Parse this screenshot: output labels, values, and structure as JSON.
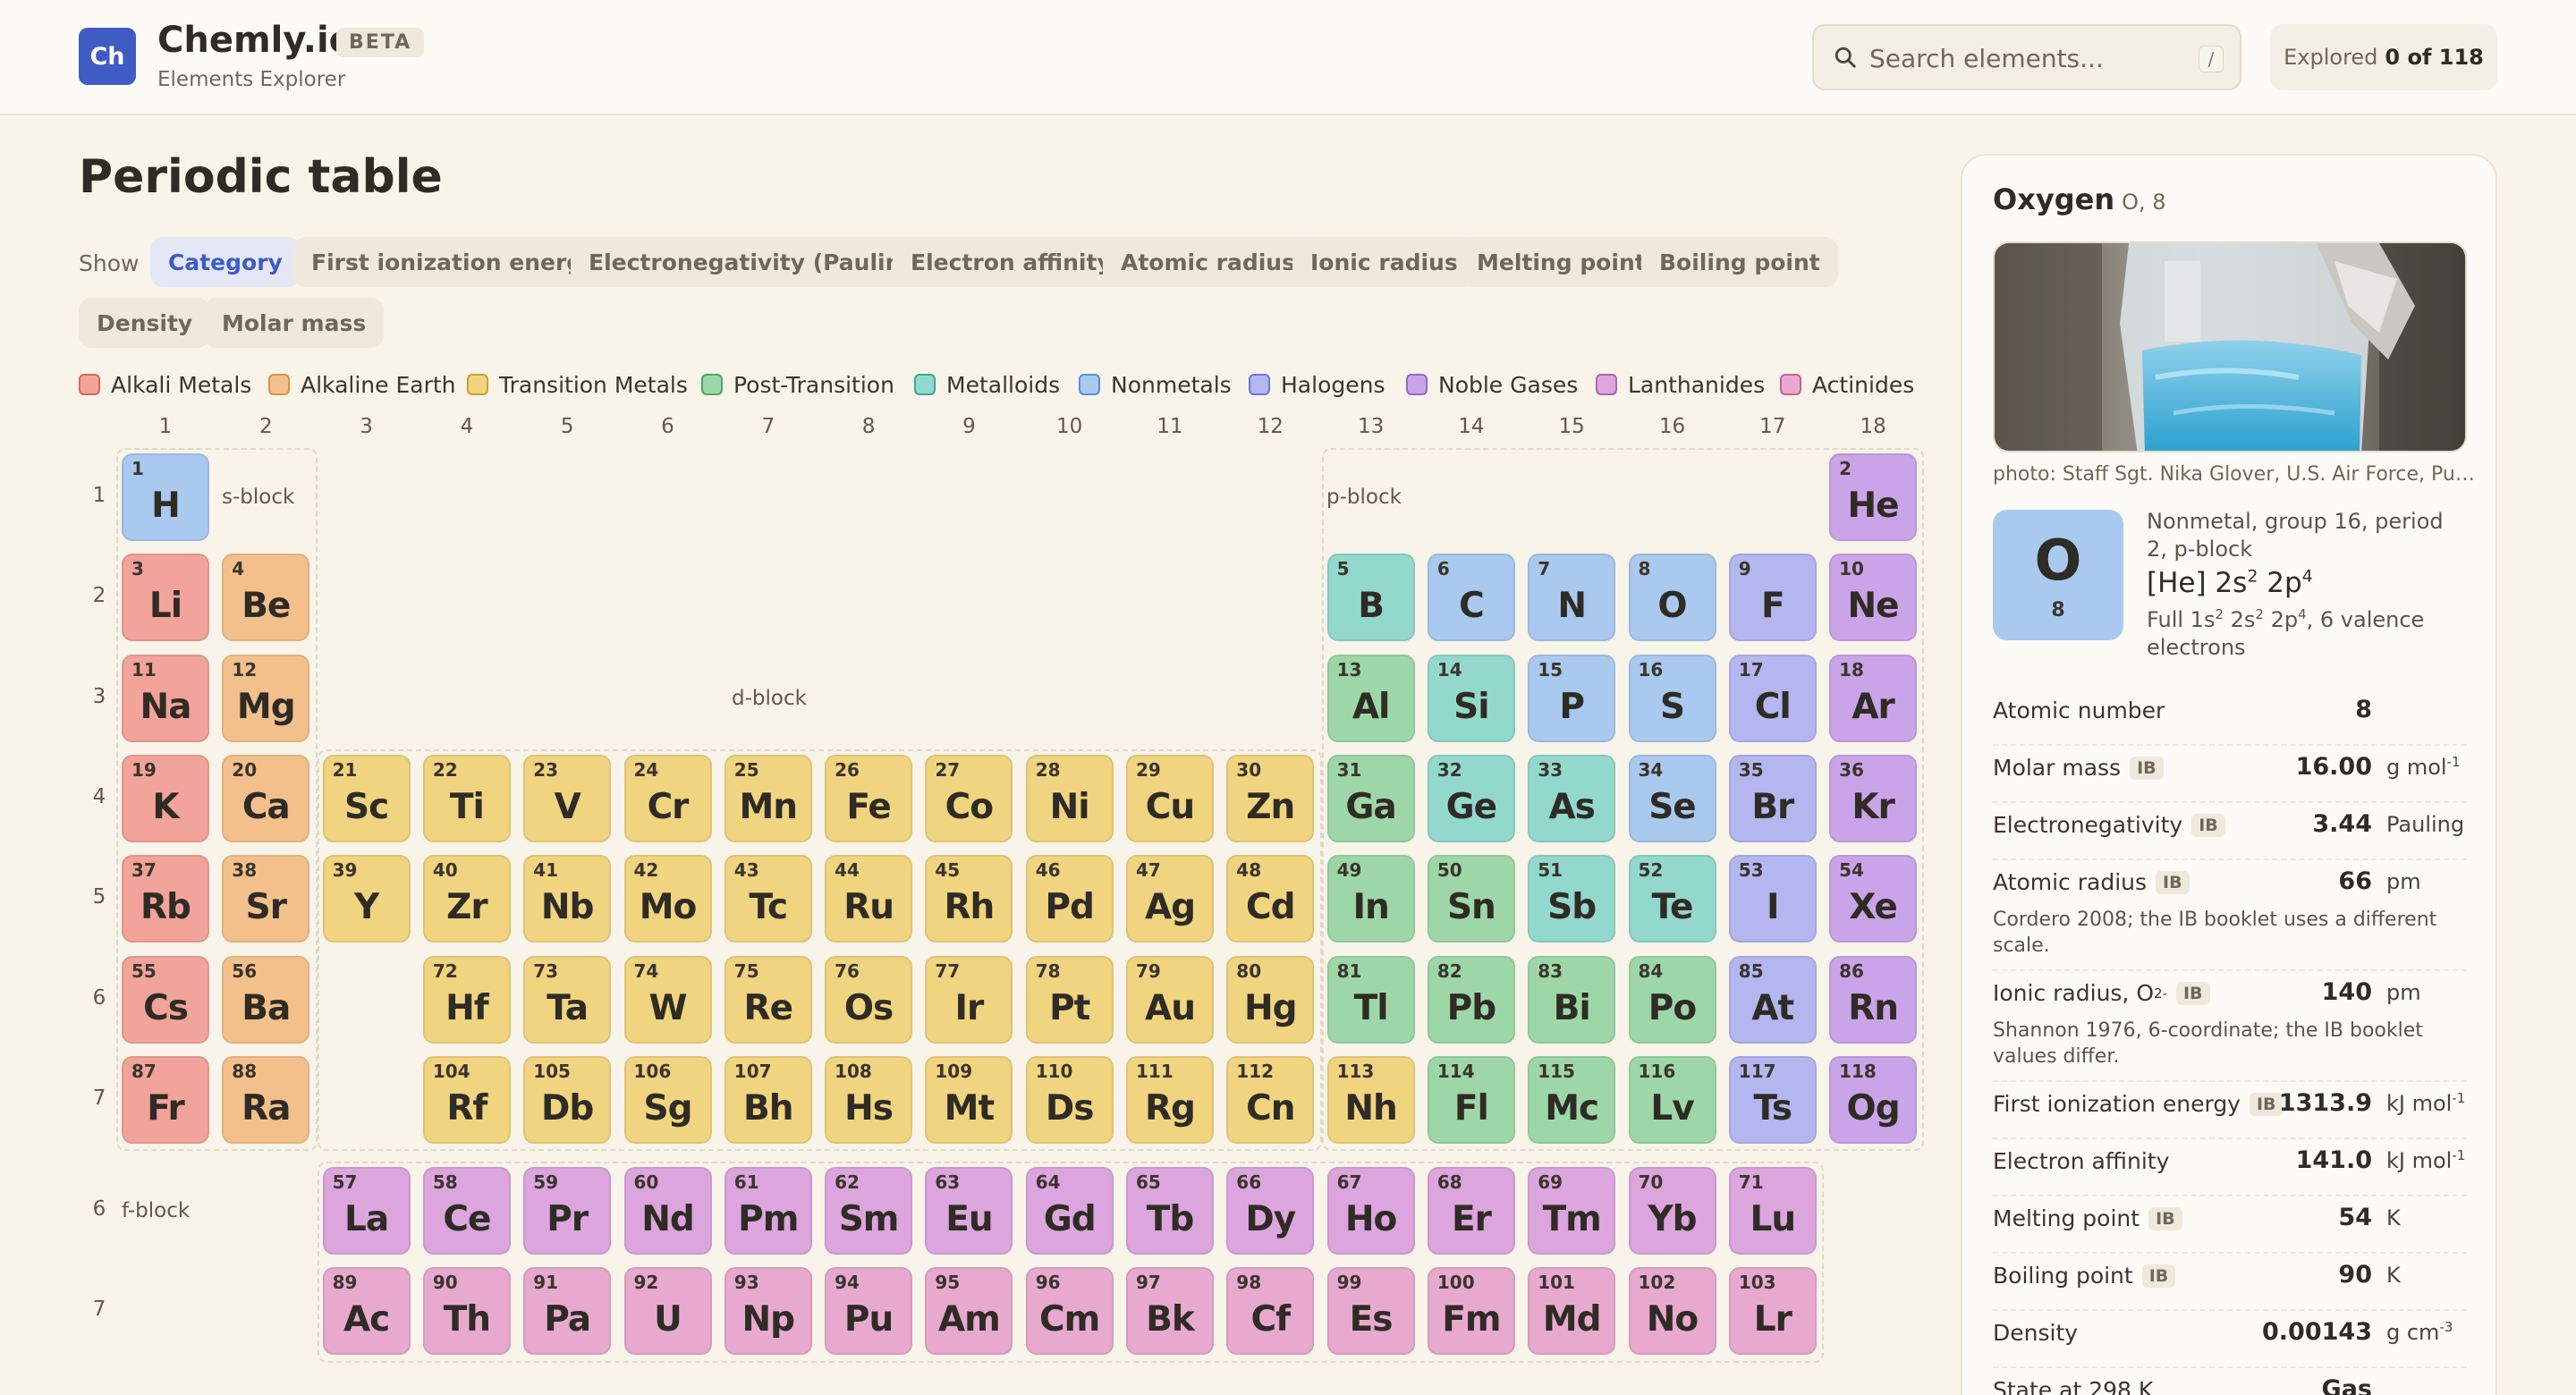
{
  "header": {
    "logo_text": "Ch",
    "brand": "Chemly.io",
    "badge": "BETA",
    "subtitle": "Elements Explorer",
    "search_placeholder": "Search elements...",
    "search_shortcut": "/",
    "explored_label": "Explored",
    "explored_value": "0 of 118"
  },
  "main": {
    "title": "Periodic table",
    "show_label": "Show",
    "tabs": [
      {
        "label": "Category",
        "active": true
      },
      {
        "label": "First ionization energy"
      },
      {
        "label": "Electronegativity (Pauling)"
      },
      {
        "label": "Electron affinity"
      },
      {
        "label": "Atomic radius"
      },
      {
        "label": "Ionic radius"
      },
      {
        "label": "Melting point"
      },
      {
        "label": "Boiling point"
      },
      {
        "label": "Density"
      },
      {
        "label": "Molar mass"
      }
    ],
    "legend": [
      {
        "key": "alkali",
        "label": "Alkali Metals",
        "color": "#f2a39a",
        "border": "#d9675b"
      },
      {
        "key": "alkaline",
        "label": "Alkaline Earth",
        "color": "#f3c08b",
        "border": "#d99245"
      },
      {
        "key": "transition",
        "label": "Transition Metals",
        "color": "#f1d47f",
        "border": "#caa232"
      },
      {
        "key": "post",
        "label": "Post-Transition",
        "color": "#9ed7a7",
        "border": "#4da865"
      },
      {
        "key": "metalloid",
        "label": "Metalloids",
        "color": "#93d8cd",
        "border": "#3aa899"
      },
      {
        "key": "nonmetal",
        "label": "Nonmetals",
        "color": "#a9c9ef",
        "border": "#5b8fd6"
      },
      {
        "key": "halogen",
        "label": "Halogens",
        "color": "#b3b6ef",
        "border": "#7176d4"
      },
      {
        "key": "noble",
        "label": "Noble Gases",
        "color": "#caa4e8",
        "border": "#9a66cc"
      },
      {
        "key": "lanthanide",
        "label": "Lanthanides",
        "color": "#dca5de",
        "border": "#b162b4"
      },
      {
        "key": "actinide",
        "label": "Actinides",
        "color": "#e8a9cf",
        "border": "#c5629e"
      }
    ],
    "group_labels": [
      "1",
      "2",
      "3",
      "4",
      "5",
      "6",
      "7",
      "8",
      "9",
      "10",
      "11",
      "12",
      "13",
      "14",
      "15",
      "16",
      "17",
      "18"
    ],
    "period_labels": [
      "1",
      "2",
      "3",
      "4",
      "5",
      "6",
      "7"
    ],
    "f_period_labels": [
      "6",
      "7"
    ],
    "block_labels": {
      "s": "s-block",
      "p": "p-block",
      "d": "d-block",
      "f": "f-block"
    }
  },
  "elements": [
    {
      "n": 1,
      "s": "H",
      "p": 1,
      "g": 1,
      "c": "nonmetal"
    },
    {
      "n": 2,
      "s": "He",
      "p": 1,
      "g": 18,
      "c": "noble"
    },
    {
      "n": 3,
      "s": "Li",
      "p": 2,
      "g": 1,
      "c": "alkali"
    },
    {
      "n": 4,
      "s": "Be",
      "p": 2,
      "g": 2,
      "c": "alkaline"
    },
    {
      "n": 5,
      "s": "B",
      "p": 2,
      "g": 13,
      "c": "metalloid"
    },
    {
      "n": 6,
      "s": "C",
      "p": 2,
      "g": 14,
      "c": "nonmetal"
    },
    {
      "n": 7,
      "s": "N",
      "p": 2,
      "g": 15,
      "c": "nonmetal"
    },
    {
      "n": 8,
      "s": "O",
      "p": 2,
      "g": 16,
      "c": "nonmetal"
    },
    {
      "n": 9,
      "s": "F",
      "p": 2,
      "g": 17,
      "c": "halogen"
    },
    {
      "n": 10,
      "s": "Ne",
      "p": 2,
      "g": 18,
      "c": "noble"
    },
    {
      "n": 11,
      "s": "Na",
      "p": 3,
      "g": 1,
      "c": "alkali"
    },
    {
      "n": 12,
      "s": "Mg",
      "p": 3,
      "g": 2,
      "c": "alkaline"
    },
    {
      "n": 13,
      "s": "Al",
      "p": 3,
      "g": 13,
      "c": "post"
    },
    {
      "n": 14,
      "s": "Si",
      "p": 3,
      "g": 14,
      "c": "metalloid"
    },
    {
      "n": 15,
      "s": "P",
      "p": 3,
      "g": 15,
      "c": "nonmetal"
    },
    {
      "n": 16,
      "s": "S",
      "p": 3,
      "g": 16,
      "c": "nonmetal"
    },
    {
      "n": 17,
      "s": "Cl",
      "p": 3,
      "g": 17,
      "c": "halogen"
    },
    {
      "n": 18,
      "s": "Ar",
      "p": 3,
      "g": 18,
      "c": "noble"
    },
    {
      "n": 19,
      "s": "K",
      "p": 4,
      "g": 1,
      "c": "alkali"
    },
    {
      "n": 20,
      "s": "Ca",
      "p": 4,
      "g": 2,
      "c": "alkaline"
    },
    {
      "n": 21,
      "s": "Sc",
      "p": 4,
      "g": 3,
      "c": "transition"
    },
    {
      "n": 22,
      "s": "Ti",
      "p": 4,
      "g": 4,
      "c": "transition"
    },
    {
      "n": 23,
      "s": "V",
      "p": 4,
      "g": 5,
      "c": "transition"
    },
    {
      "n": 24,
      "s": "Cr",
      "p": 4,
      "g": 6,
      "c": "transition"
    },
    {
      "n": 25,
      "s": "Mn",
      "p": 4,
      "g": 7,
      "c": "transition"
    },
    {
      "n": 26,
      "s": "Fe",
      "p": 4,
      "g": 8,
      "c": "transition"
    },
    {
      "n": 27,
      "s": "Co",
      "p": 4,
      "g": 9,
      "c": "transition"
    },
    {
      "n": 28,
      "s": "Ni",
      "p": 4,
      "g": 10,
      "c": "transition"
    },
    {
      "n": 29,
      "s": "Cu",
      "p": 4,
      "g": 11,
      "c": "transition"
    },
    {
      "n": 30,
      "s": "Zn",
      "p": 4,
      "g": 12,
      "c": "transition"
    },
    {
      "n": 31,
      "s": "Ga",
      "p": 4,
      "g": 13,
      "c": "post"
    },
    {
      "n": 32,
      "s": "Ge",
      "p": 4,
      "g": 14,
      "c": "metalloid"
    },
    {
      "n": 33,
      "s": "As",
      "p": 4,
      "g": 15,
      "c": "metalloid"
    },
    {
      "n": 34,
      "s": "Se",
      "p": 4,
      "g": 16,
      "c": "nonmetal"
    },
    {
      "n": 35,
      "s": "Br",
      "p": 4,
      "g": 17,
      "c": "halogen"
    },
    {
      "n": 36,
      "s": "Kr",
      "p": 4,
      "g": 18,
      "c": "noble"
    },
    {
      "n": 37,
      "s": "Rb",
      "p": 5,
      "g": 1,
      "c": "alkali"
    },
    {
      "n": 38,
      "s": "Sr",
      "p": 5,
      "g": 2,
      "c": "alkaline"
    },
    {
      "n": 39,
      "s": "Y",
      "p": 5,
      "g": 3,
      "c": "transition"
    },
    {
      "n": 40,
      "s": "Zr",
      "p": 5,
      "g": 4,
      "c": "transition"
    },
    {
      "n": 41,
      "s": "Nb",
      "p": 5,
      "g": 5,
      "c": "transition"
    },
    {
      "n": 42,
      "s": "Mo",
      "p": 5,
      "g": 6,
      "c": "transition"
    },
    {
      "n": 43,
      "s": "Tc",
      "p": 5,
      "g": 7,
      "c": "transition"
    },
    {
      "n": 44,
      "s": "Ru",
      "p": 5,
      "g": 8,
      "c": "transition"
    },
    {
      "n": 45,
      "s": "Rh",
      "p": 5,
      "g": 9,
      "c": "transition"
    },
    {
      "n": 46,
      "s": "Pd",
      "p": 5,
      "g": 10,
      "c": "transition"
    },
    {
      "n": 47,
      "s": "Ag",
      "p": 5,
      "g": 11,
      "c": "transition"
    },
    {
      "n": 48,
      "s": "Cd",
      "p": 5,
      "g": 12,
      "c": "transition"
    },
    {
      "n": 49,
      "s": "In",
      "p": 5,
      "g": 13,
      "c": "post"
    },
    {
      "n": 50,
      "s": "Sn",
      "p": 5,
      "g": 14,
      "c": "post"
    },
    {
      "n": 51,
      "s": "Sb",
      "p": 5,
      "g": 15,
      "c": "metalloid"
    },
    {
      "n": 52,
      "s": "Te",
      "p": 5,
      "g": 16,
      "c": "metalloid"
    },
    {
      "n": 53,
      "s": "I",
      "p": 5,
      "g": 17,
      "c": "halogen"
    },
    {
      "n": 54,
      "s": "Xe",
      "p": 5,
      "g": 18,
      "c": "noble"
    },
    {
      "n": 55,
      "s": "Cs",
      "p": 6,
      "g": 1,
      "c": "alkali"
    },
    {
      "n": 56,
      "s": "Ba",
      "p": 6,
      "g": 2,
      "c": "alkaline"
    },
    {
      "n": 72,
      "s": "Hf",
      "p": 6,
      "g": 4,
      "c": "transition"
    },
    {
      "n": 73,
      "s": "Ta",
      "p": 6,
      "g": 5,
      "c": "transition"
    },
    {
      "n": 74,
      "s": "W",
      "p": 6,
      "g": 6,
      "c": "transition"
    },
    {
      "n": 75,
      "s": "Re",
      "p": 6,
      "g": 7,
      "c": "transition"
    },
    {
      "n": 76,
      "s": "Os",
      "p": 6,
      "g": 8,
      "c": "transition"
    },
    {
      "n": 77,
      "s": "Ir",
      "p": 6,
      "g": 9,
      "c": "transition"
    },
    {
      "n": 78,
      "s": "Pt",
      "p": 6,
      "g": 10,
      "c": "transition"
    },
    {
      "n": 79,
      "s": "Au",
      "p": 6,
      "g": 11,
      "c": "transition"
    },
    {
      "n": 80,
      "s": "Hg",
      "p": 6,
      "g": 12,
      "c": "transition"
    },
    {
      "n": 81,
      "s": "Tl",
      "p": 6,
      "g": 13,
      "c": "post"
    },
    {
      "n": 82,
      "s": "Pb",
      "p": 6,
      "g": 14,
      "c": "post"
    },
    {
      "n": 83,
      "s": "Bi",
      "p": 6,
      "g": 15,
      "c": "post"
    },
    {
      "n": 84,
      "s": "Po",
      "p": 6,
      "g": 16,
      "c": "post"
    },
    {
      "n": 85,
      "s": "At",
      "p": 6,
      "g": 17,
      "c": "halogen"
    },
    {
      "n": 86,
      "s": "Rn",
      "p": 6,
      "g": 18,
      "c": "noble"
    },
    {
      "n": 87,
      "s": "Fr",
      "p": 7,
      "g": 1,
      "c": "alkali"
    },
    {
      "n": 88,
      "s": "Ra",
      "p": 7,
      "g": 2,
      "c": "alkaline"
    },
    {
      "n": 104,
      "s": "Rf",
      "p": 7,
      "g": 4,
      "c": "transition"
    },
    {
      "n": 105,
      "s": "Db",
      "p": 7,
      "g": 5,
      "c": "transition"
    },
    {
      "n": 106,
      "s": "Sg",
      "p": 7,
      "g": 6,
      "c": "transition"
    },
    {
      "n": 107,
      "s": "Bh",
      "p": 7,
      "g": 7,
      "c": "transition"
    },
    {
      "n": 108,
      "s": "Hs",
      "p": 7,
      "g": 8,
      "c": "transition"
    },
    {
      "n": 109,
      "s": "Mt",
      "p": 7,
      "g": 9,
      "c": "transition"
    },
    {
      "n": 110,
      "s": "Ds",
      "p": 7,
      "g": 10,
      "c": "transition"
    },
    {
      "n": 111,
      "s": "Rg",
      "p": 7,
      "g": 11,
      "c": "transition"
    },
    {
      "n": 112,
      "s": "Cn",
      "p": 7,
      "g": 12,
      "c": "transition"
    },
    {
      "n": 113,
      "s": "Nh",
      "p": 7,
      "g": 13,
      "c": "transition"
    },
    {
      "n": 114,
      "s": "Fl",
      "p": 7,
      "g": 14,
      "c": "post"
    },
    {
      "n": 115,
      "s": "Mc",
      "p": 7,
      "g": 15,
      "c": "post"
    },
    {
      "n": 116,
      "s": "Lv",
      "p": 7,
      "g": 16,
      "c": "post"
    },
    {
      "n": 117,
      "s": "Ts",
      "p": 7,
      "g": 17,
      "c": "halogen"
    },
    {
      "n": 118,
      "s": "Og",
      "p": 7,
      "g": 18,
      "c": "noble"
    },
    {
      "n": 57,
      "s": "La",
      "fp": 6,
      "g": 3,
      "c": "lanthanide"
    },
    {
      "n": 58,
      "s": "Ce",
      "fp": 6,
      "g": 4,
      "c": "lanthanide"
    },
    {
      "n": 59,
      "s": "Pr",
      "fp": 6,
      "g": 5,
      "c": "lanthanide"
    },
    {
      "n": 60,
      "s": "Nd",
      "fp": 6,
      "g": 6,
      "c": "lanthanide"
    },
    {
      "n": 61,
      "s": "Pm",
      "fp": 6,
      "g": 7,
      "c": "lanthanide"
    },
    {
      "n": 62,
      "s": "Sm",
      "fp": 6,
      "g": 8,
      "c": "lanthanide"
    },
    {
      "n": 63,
      "s": "Eu",
      "fp": 6,
      "g": 9,
      "c": "lanthanide"
    },
    {
      "n": 64,
      "s": "Gd",
      "fp": 6,
      "g": 10,
      "c": "lanthanide"
    },
    {
      "n": 65,
      "s": "Tb",
      "fp": 6,
      "g": 11,
      "c": "lanthanide"
    },
    {
      "n": 66,
      "s": "Dy",
      "fp": 6,
      "g": 12,
      "c": "lanthanide"
    },
    {
      "n": 67,
      "s": "Ho",
      "fp": 6,
      "g": 13,
      "c": "lanthanide"
    },
    {
      "n": 68,
      "s": "Er",
      "fp": 6,
      "g": 14,
      "c": "lanthanide"
    },
    {
      "n": 69,
      "s": "Tm",
      "fp": 6,
      "g": 15,
      "c": "lanthanide"
    },
    {
      "n": 70,
      "s": "Yb",
      "fp": 6,
      "g": 16,
      "c": "lanthanide"
    },
    {
      "n": 71,
      "s": "Lu",
      "fp": 6,
      "g": 17,
      "c": "lanthanide"
    },
    {
      "n": 89,
      "s": "Ac",
      "fp": 7,
      "g": 3,
      "c": "actinide"
    },
    {
      "n": 90,
      "s": "Th",
      "fp": 7,
      "g": 4,
      "c": "actinide"
    },
    {
      "n": 91,
      "s": "Pa",
      "fp": 7,
      "g": 5,
      "c": "actinide"
    },
    {
      "n": 92,
      "s": "U",
      "fp": 7,
      "g": 6,
      "c": "actinide"
    },
    {
      "n": 93,
      "s": "Np",
      "fp": 7,
      "g": 7,
      "c": "actinide"
    },
    {
      "n": 94,
      "s": "Pu",
      "fp": 7,
      "g": 8,
      "c": "actinide"
    },
    {
      "n": 95,
      "s": "Am",
      "fp": 7,
      "g": 9,
      "c": "actinide"
    },
    {
      "n": 96,
      "s": "Cm",
      "fp": 7,
      "g": 10,
      "c": "actinide"
    },
    {
      "n": 97,
      "s": "Bk",
      "fp": 7,
      "g": 11,
      "c": "actinide"
    },
    {
      "n": 98,
      "s": "Cf",
      "fp": 7,
      "g": 12,
      "c": "actinide"
    },
    {
      "n": 99,
      "s": "Es",
      "fp": 7,
      "g": 13,
      "c": "actinide"
    },
    {
      "n": 100,
      "s": "Fm",
      "fp": 7,
      "g": 14,
      "c": "actinide"
    },
    {
      "n": 101,
      "s": "Md",
      "fp": 7,
      "g": 15,
      "c": "actinide"
    },
    {
      "n": 102,
      "s": "No",
      "fp": 7,
      "g": 16,
      "c": "actinide"
    },
    {
      "n": 103,
      "s": "Lr",
      "fp": 7,
      "g": 17,
      "c": "actinide"
    }
  ],
  "panel": {
    "name": "Oxygen",
    "name_meta": "O, 8",
    "photo_credit": "photo: Staff Sgt. Nika Glover, U.S. Air Force, Public domain",
    "symbol": "O",
    "number": "8",
    "description": "Nonmetal, group 16, period 2, p-block",
    "config_core": "[He] 2s",
    "config_exp1": "2",
    "config_mid": " 2p",
    "config_exp2": "4",
    "full_config_prefix": "Full 1s",
    "full_config_e1": "2",
    "full_config_mid1": " 2s",
    "full_config_e2": "2",
    "full_config_mid2": " 2p",
    "full_config_e3": "4",
    "full_config_suffix": ", 6 valence electrons",
    "ib_badge": "IB",
    "props": [
      {
        "label": "Atomic number",
        "value": "8",
        "unit": "",
        "ib": false
      },
      {
        "label": "Molar mass",
        "value": "16.00",
        "unit": "g mol",
        "unit_sup": "-1",
        "ib": true
      },
      {
        "label": "Electronegativity",
        "value": "3.44",
        "unit": "Pauling",
        "ib": true
      },
      {
        "label": "Atomic radius",
        "value": "66",
        "unit": "pm",
        "ib": true,
        "note": "Cordero 2008; the IB booklet uses a different scale."
      },
      {
        "label": "Ionic radius, O",
        "label_sup": "2-",
        "value": "140",
        "unit": "pm",
        "ib": true,
        "note": "Shannon 1976, 6-coordinate; the IB booklet values differ."
      },
      {
        "label": "First ionization energy",
        "value": "1313.9",
        "unit": "kJ mol",
        "unit_sup": "-1",
        "ib": true
      },
      {
        "label": "Electron affinity",
        "value": "141.0",
        "unit": "kJ mol",
        "unit_sup": "-1",
        "ib": false
      },
      {
        "label": "Melting point",
        "value": "54",
        "unit": "K",
        "ib": true
      },
      {
        "label": "Boiling point",
        "value": "90",
        "unit": "K",
        "ib": true
      },
      {
        "label": "Density",
        "value": "0.00143",
        "unit": "g cm",
        "unit_sup": "-3",
        "ib": false
      },
      {
        "label": "State at 298 K",
        "value": "Gas",
        "unit": "",
        "ib": false
      }
    ]
  }
}
